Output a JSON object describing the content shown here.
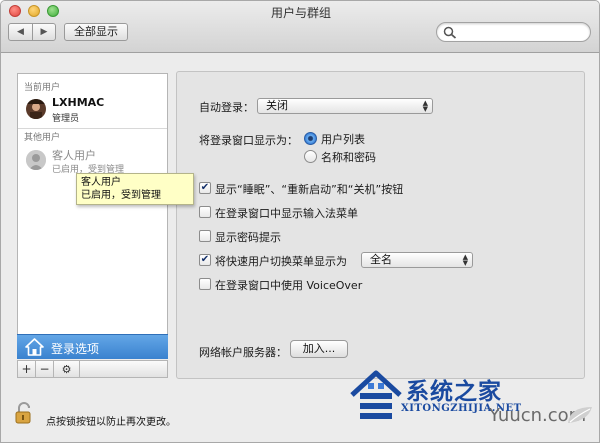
{
  "window": {
    "title": "用户与群组"
  },
  "toolbar": {
    "back_glyph": "◀",
    "forward_glyph": "▶",
    "show_all_label": "全部显示",
    "search_placeholder": "",
    "search_icon": "magnifier-icon"
  },
  "sidebar": {
    "current_users_heading": "当前用户",
    "current_user": {
      "name": "LXHMAC",
      "role": "管理员"
    },
    "other_users_heading": "其他用户",
    "guest": {
      "name": "客人用户",
      "status": "已启用，受到管理"
    },
    "login_options_label": "登录选项",
    "add_glyph": "+",
    "remove_glyph": "−",
    "action_glyph": "⚙"
  },
  "tooltip": {
    "line1": "客人用户",
    "line2": "已启用，受到管理"
  },
  "panel": {
    "auto_login_label": "自动登录：",
    "auto_login_value": "关闭",
    "display_label": "将登录窗口显示为：",
    "display_options": [
      {
        "label": "用户列表",
        "selected": true
      },
      {
        "label": "名称和密码",
        "selected": false
      }
    ],
    "checkboxes": [
      {
        "label": "显示“睡眠”、“重新启动”和“关机”按钮",
        "checked": true
      },
      {
        "label": "在登录窗口中显示输入法菜单",
        "checked": false
      },
      {
        "label": "显示密码提示",
        "checked": false
      },
      {
        "label": "将快速用户切换菜单显示为",
        "checked": true
      },
      {
        "label": "在登录窗口中使用 VoiceOver",
        "checked": false
      }
    ],
    "fast_switch_value": "全名",
    "check_glyph": "✔",
    "network_server_label": "网络帐户服务器：",
    "join_button_label": "加入..."
  },
  "lock": {
    "text": "点按锁按钮以防止再次更改。"
  },
  "watermark": {
    "title": "系统之家",
    "subtitle": "XITONGZHIJIA.NET",
    "site": "Yuucn.com"
  },
  "colors": {
    "selection": "#3a82cf",
    "tooltip_bg": "#ffffc6",
    "watermark": "#1a4aa0"
  }
}
